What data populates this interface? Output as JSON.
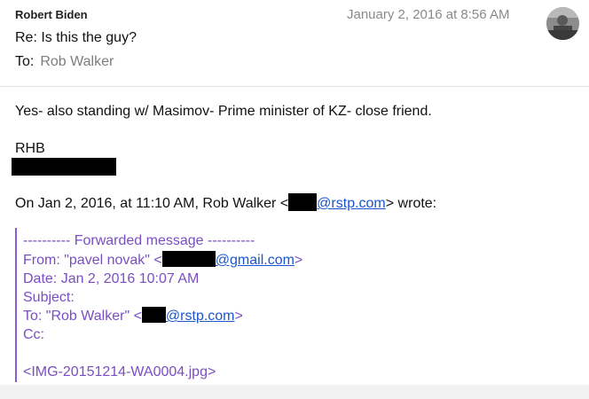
{
  "header": {
    "sender": "Robert Biden",
    "date": "January 2, 2016 at 8:56 AM",
    "subject": "Re: Is this the guy?",
    "to_label": "To:",
    "to_name": "Rob Walker"
  },
  "body": {
    "line1": "Yes- also standing w/ Masimov- Prime minister of KZ- close friend.",
    "signature": "RHB",
    "quote_intro_prefix": "On Jan 2, 2016, at 11:10 AM, Rob Walker <",
    "quote_intro_link": "@rstp.com",
    "quote_intro_suffix": "> wrote:"
  },
  "forwarded": {
    "header": "---------- Forwarded message ----------",
    "from_prefix": "From: \"pavel novak\" <",
    "from_link": "@gmail.com",
    "from_suffix": ">",
    "date": "Date: Jan 2, 2016 10:07 AM",
    "subject": "Subject:",
    "to_prefix": "To: \"Rob Walker\" <",
    "to_link": "@rstp.com",
    "to_suffix": ">",
    "cc": "Cc:",
    "attachment": "<IMG-20151214-WA0004.jpg>"
  },
  "colors": {
    "quote_purple": "#7a4ec2",
    "link_blue": "#1a55cf",
    "date_gray": "#8a8a8a"
  }
}
